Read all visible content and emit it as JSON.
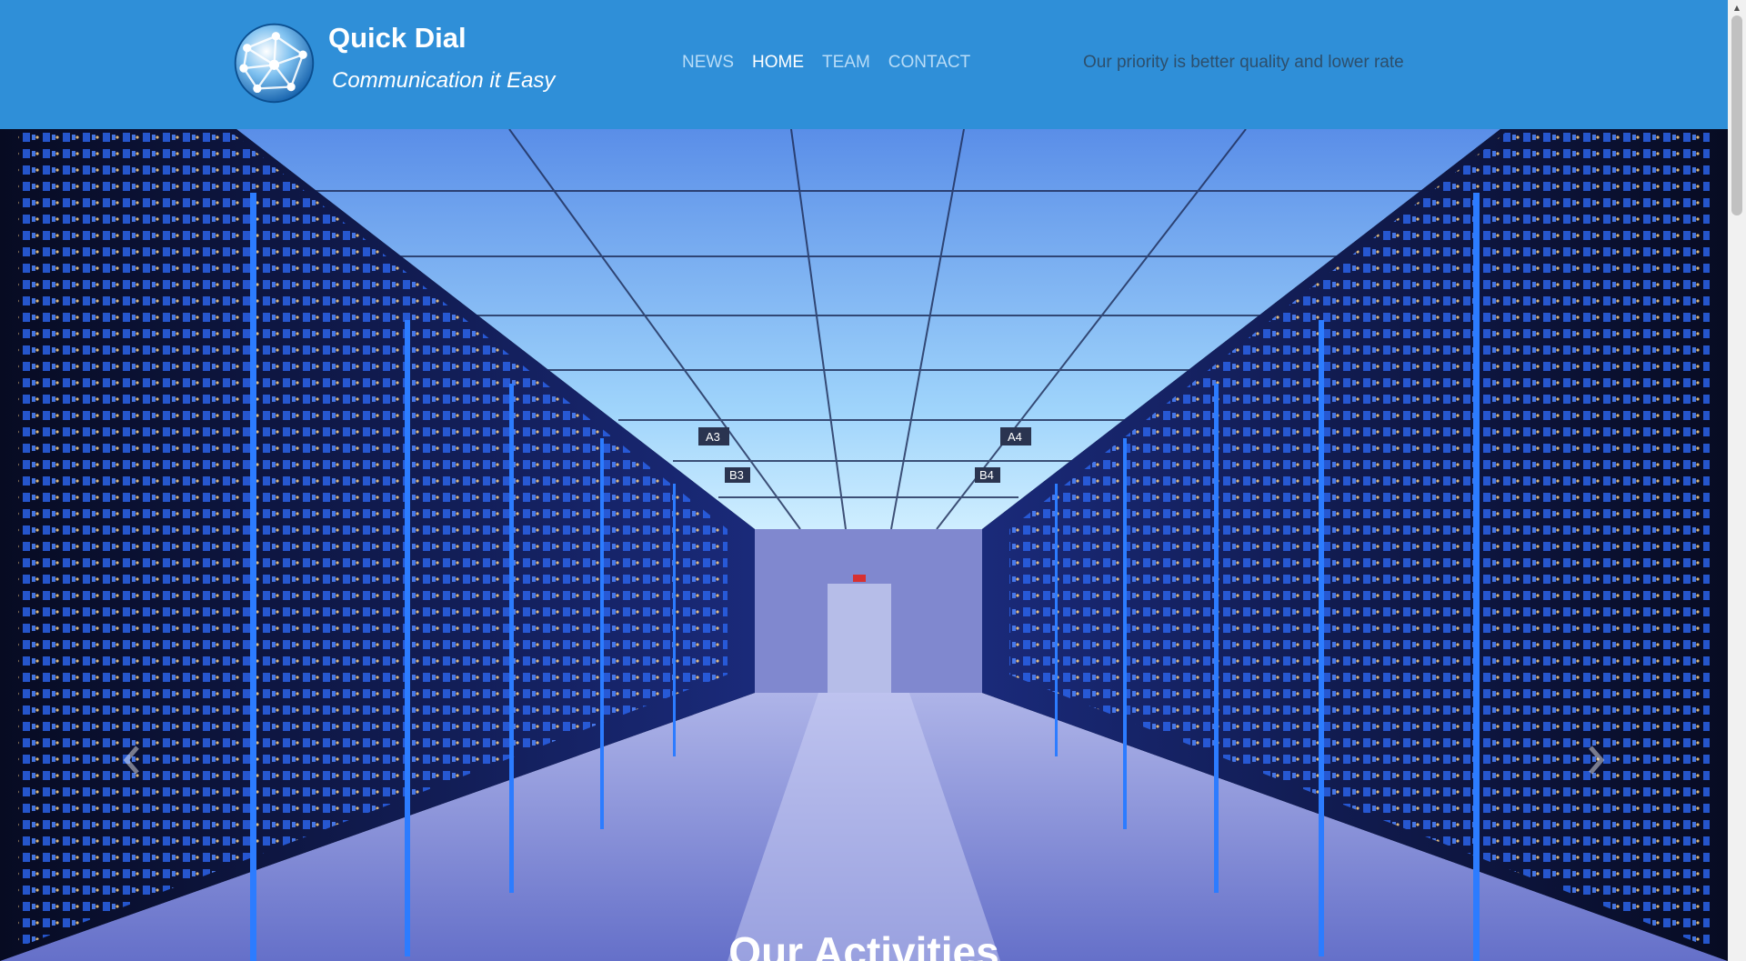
{
  "header": {
    "brand_name": "Quick Dial",
    "tagline": "Communication it Easy",
    "slogan": "Our priority is better quality and lower rate",
    "colors": {
      "background": "#2f8fd8",
      "nav_link": "#b8dcf7",
      "nav_active": "#ffffff"
    }
  },
  "nav": {
    "items": [
      {
        "label": "NEWS",
        "active": false
      },
      {
        "label": "HOME",
        "active": true
      },
      {
        "label": "TEAM",
        "active": false
      },
      {
        "label": "CONTACT",
        "active": false
      }
    ]
  },
  "hero": {
    "image": "server-room-photo",
    "signs": [
      "A3",
      "B3",
      "A4",
      "B4"
    ],
    "heading": "Our Activities",
    "prev_icon": "chevron-left-icon",
    "next_icon": "chevron-right-icon"
  }
}
